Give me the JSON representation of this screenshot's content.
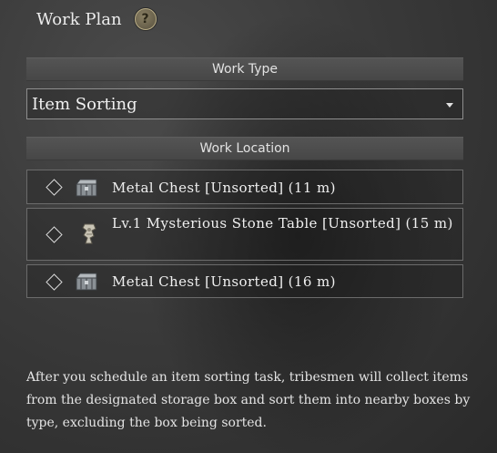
{
  "header": {
    "title": "Work Plan",
    "help_label": "?"
  },
  "work_type": {
    "section_label": "Work Type",
    "selected": "Item Sorting"
  },
  "work_location": {
    "section_label": "Work Location",
    "items": [
      {
        "label": "Metal Chest [Unsorted]  (11 m)",
        "icon": "metal-chest-icon"
      },
      {
        "label": "Lv.1 Mysterious Stone Table [Unsorted]  (15 m)",
        "icon": "stone-table-icon"
      },
      {
        "label": "Metal Chest [Unsorted]  (16 m)",
        "icon": "metal-chest-icon"
      }
    ]
  },
  "description": "After you schedule an item sorting task, tribesmen will collect items from the designated storage box and sort them into nearby boxes by type, excluding the box being sorted.",
  "colors": {
    "background": "#3a3a3a",
    "section_bar": "#4d4d4d",
    "text": "#ececec",
    "help_gold": "#b9ad86"
  }
}
